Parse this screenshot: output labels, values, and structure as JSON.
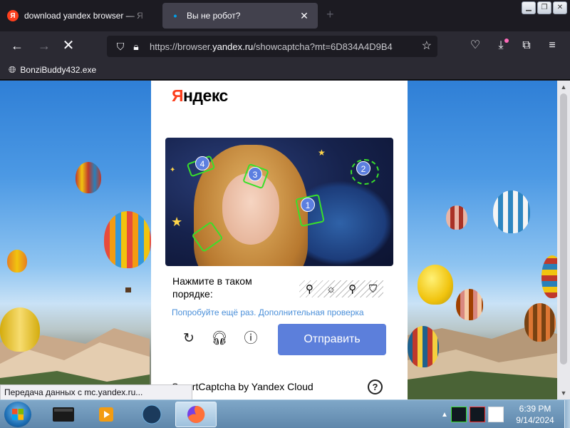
{
  "browser": {
    "tabs": [
      {
        "title": "download yandex browser — Я",
        "active": false
      },
      {
        "title": "Вы не робот?",
        "active": true
      }
    ],
    "url_prefix": "https://browser.",
    "url_domain": "yandex.ru",
    "url_path": "/showcaptcha?mt=6D834A4D9B4",
    "bookmarks": [
      "BonziBuddy432.exe"
    ]
  },
  "captcha": {
    "logo": "Яндекс",
    "instruction": "Нажмите в таком порядке:",
    "markers": [
      "1",
      "2",
      "3",
      "4"
    ],
    "task_icons": [
      "⚲",
      "☼",
      "⚲",
      "⛉"
    ],
    "retry_link": "Попробуйте ещё раз.",
    "extra_check_link": "Дополнительная проверка",
    "submit_label": "Отправить",
    "footer": "SmartCaptcha by Yandex Cloud",
    "help": "?"
  },
  "status_tooltip": "Передача данных с mc.yandex.ru...",
  "taskbar": {
    "time": "6:39 PM",
    "date": "9/14/2024"
  },
  "colors": {
    "accent_button": "#5c7fdb",
    "link": "#4a8fd9",
    "yandex_red": "#fc3f1d",
    "outline_green": "#39e02a"
  }
}
